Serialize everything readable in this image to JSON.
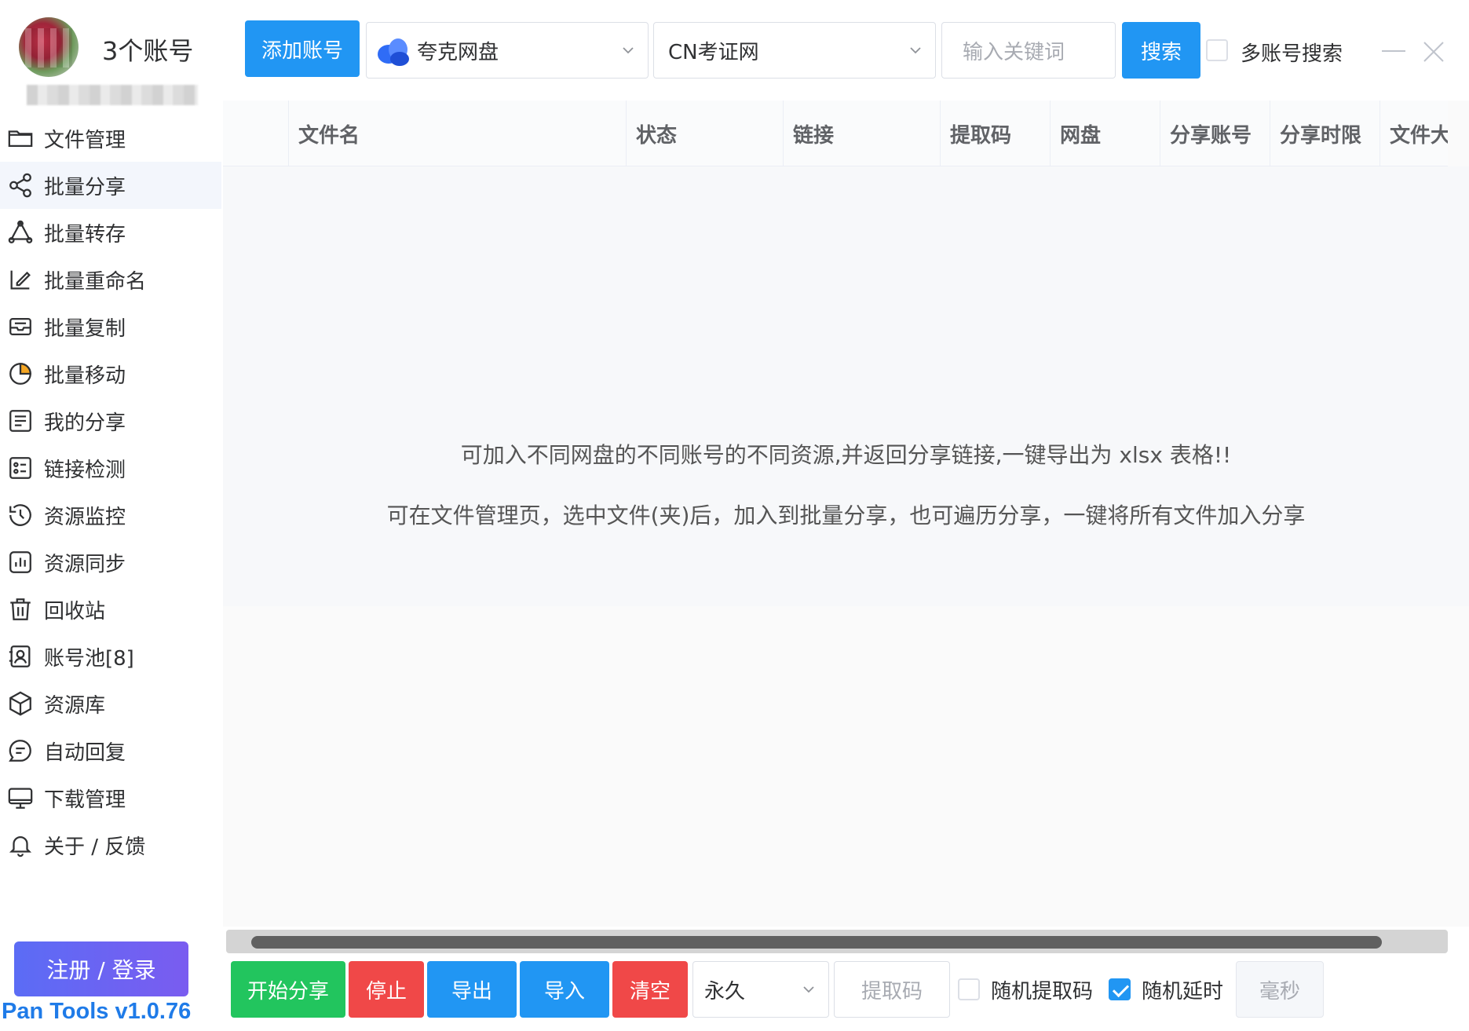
{
  "sidebar": {
    "account_count": "3个账号",
    "menu": [
      {
        "label": "文件管理",
        "icon": "folder-icon"
      },
      {
        "label": "批量分享",
        "icon": "share-icon",
        "active": true
      },
      {
        "label": "批量转存",
        "icon": "transfer-icon"
      },
      {
        "label": "批量重命名",
        "icon": "rename-icon"
      },
      {
        "label": "批量复制",
        "icon": "copy-icon"
      },
      {
        "label": "批量移动",
        "icon": "move-icon"
      },
      {
        "label": "我的分享",
        "icon": "my-share-icon"
      },
      {
        "label": "链接检测",
        "icon": "link-check-icon"
      },
      {
        "label": "资源监控",
        "icon": "monitor-icon"
      },
      {
        "label": "资源同步",
        "icon": "sync-icon"
      },
      {
        "label": "回收站",
        "icon": "trash-icon"
      },
      {
        "label": "账号池[8]",
        "icon": "account-pool-icon"
      },
      {
        "label": "资源库",
        "icon": "library-icon"
      },
      {
        "label": "自动回复",
        "icon": "auto-reply-icon"
      },
      {
        "label": "下载管理",
        "icon": "download-icon"
      },
      {
        "label": "关于 / 反馈",
        "icon": "bell-icon"
      }
    ],
    "login_label": "注册 / 登录",
    "version": "Pan Tools v1.0.76"
  },
  "topbar": {
    "add_account_label": "添加账号",
    "pan_select_value": "夸克网盘",
    "account_select_value": "CN考证网",
    "search_placeholder": "输入关键词",
    "search_label": "搜索",
    "multi_search_label": "多账号搜索"
  },
  "table": {
    "columns": [
      "文件名",
      "状态",
      "链接",
      "提取码",
      "网盘",
      "分享账号",
      "分享时限",
      "文件大"
    ],
    "empty_line_1": "可加入不同网盘的不同账号的不同资源,并返回分享链接,一键导出为 xlsx 表格!!",
    "empty_line_2": "可在文件管理页，选中文件(夹)后，加入到批量分享，也可遍历分享，一键将所有文件加入分享"
  },
  "bottombar": {
    "start_label": "开始分享",
    "stop_label": "停止",
    "export_label": "导出",
    "import_label": "导入",
    "clear_label": "清空",
    "expiry_value": "永久",
    "code_placeholder": "提取码",
    "random_code_label": "随机提取码",
    "random_code_checked": false,
    "random_delay_label": "随机延时",
    "random_delay_checked": true,
    "ms_placeholder": "毫秒"
  },
  "colors": {
    "primary": "#2196f3",
    "success": "#22c55e",
    "danger": "#f04848",
    "version": "#1f7be8"
  }
}
